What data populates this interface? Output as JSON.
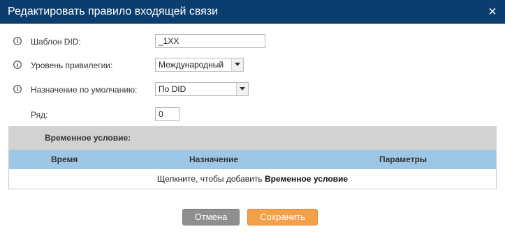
{
  "dialog": {
    "title": "Редактировать правило входящей связи",
    "close_glyph": "×"
  },
  "form": {
    "did_pattern": {
      "label": "Шаблон DID:",
      "value": "_1XX",
      "icon": "info-icon"
    },
    "privilege_level": {
      "label": "Уровень привилегии:",
      "value": "Международный",
      "icon": "info-icon"
    },
    "default_destination": {
      "label": "Назначение по умолчанию:",
      "value": "По DID",
      "icon": "info-icon"
    },
    "row": {
      "label": "Ряд:",
      "value": "0"
    }
  },
  "time_condition": {
    "title": "Временное условие:",
    "columns": [
      "Время",
      "Назначение",
      "Параметры"
    ],
    "empty_hint_prefix": "Щелкните, чтобы добавить ",
    "empty_hint_link": "Временное условие"
  },
  "buttons": {
    "cancel": "Отмена",
    "save": "Сохранить"
  },
  "colors": {
    "titlebar": "#0b3d6f",
    "section_header": "#d2d2d2",
    "table_header": "#9dc7e5",
    "cancel_button": "#8f8f8f",
    "save_button": "#f3a04a"
  }
}
